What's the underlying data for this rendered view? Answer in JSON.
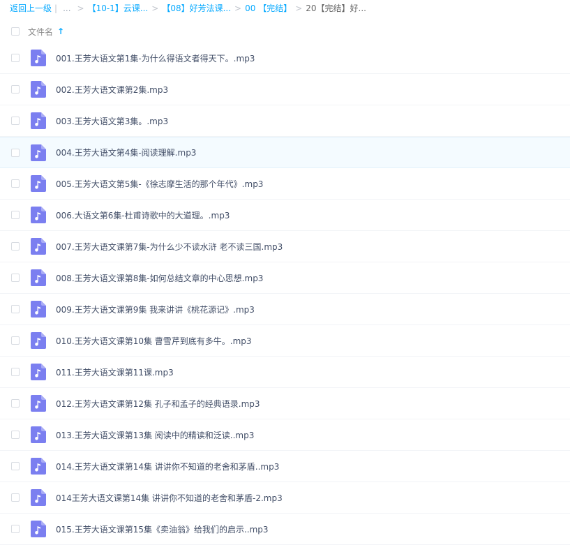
{
  "breadcrumb": {
    "back_label": "返回上一级",
    "pipe": "|",
    "ellipsis": "...",
    "sep": ">",
    "items": [
      "【10-1】云课...",
      "【08】好芳法课...",
      "00 【完结】"
    ],
    "current": "20【完结】好..."
  },
  "header": {
    "column_label": "文件名",
    "sort_icon": "arrow-up-icon",
    "sort_glyph": "↑"
  },
  "colors": {
    "link": "#09aaff",
    "icon_bg": "#7b7ff0",
    "hover_row": "#f4fbff"
  },
  "files": [
    {
      "name": "001.王芳大语文第1集-为什么得语文者得天下。.mp3",
      "icon": "music-file-icon"
    },
    {
      "name": "002.王芳大语文课第2集.mp3",
      "icon": "music-file-icon"
    },
    {
      "name": "003.王芳大语文第3集。.mp3",
      "icon": "music-file-icon"
    },
    {
      "name": "004.王芳大语文第4集-阅读理解.mp3",
      "icon": "music-file-icon",
      "hovered": true
    },
    {
      "name": "005.王芳大语文第5集-《徐志摩生活的那个年代》.mp3",
      "icon": "music-file-icon"
    },
    {
      "name": "006.大语文第6集-杜甫诗歌中的大道理。.mp3",
      "icon": "music-file-icon"
    },
    {
      "name": "007.王芳大语文课第7集-为什么少不读水浒 老不读三国.mp3",
      "icon": "music-file-icon"
    },
    {
      "name": "008.王芳大语文课第8集-如何总结文章的中心思想.mp3",
      "icon": "music-file-icon"
    },
    {
      "name": "009.王芳大语文课第9集 我来讲讲《桃花源记》.mp3",
      "icon": "music-file-icon"
    },
    {
      "name": "010.王芳大语文课第10集 曹雪芹到底有多牛。.mp3",
      "icon": "music-file-icon"
    },
    {
      "name": "011.王芳大语文课第11课.mp3",
      "icon": "music-file-icon"
    },
    {
      "name": "012.王芳大语文课第12集 孔子和孟子的经典语录.mp3",
      "icon": "music-file-icon"
    },
    {
      "name": "013.王芳大语文课第13集 阅读中的精读和泛读..mp3",
      "icon": "music-file-icon"
    },
    {
      "name": "014.王芳大语文课第14集 讲讲你不知道的老舍和茅盾..mp3",
      "icon": "music-file-icon"
    },
    {
      "name": "014王芳大语文课第14集 讲讲你不知道的老舍和茅盾-2.mp3",
      "icon": "music-file-icon"
    },
    {
      "name": "015.王芳大语文课第15集《卖油翁》给我们的启示..mp3",
      "icon": "music-file-icon"
    }
  ]
}
